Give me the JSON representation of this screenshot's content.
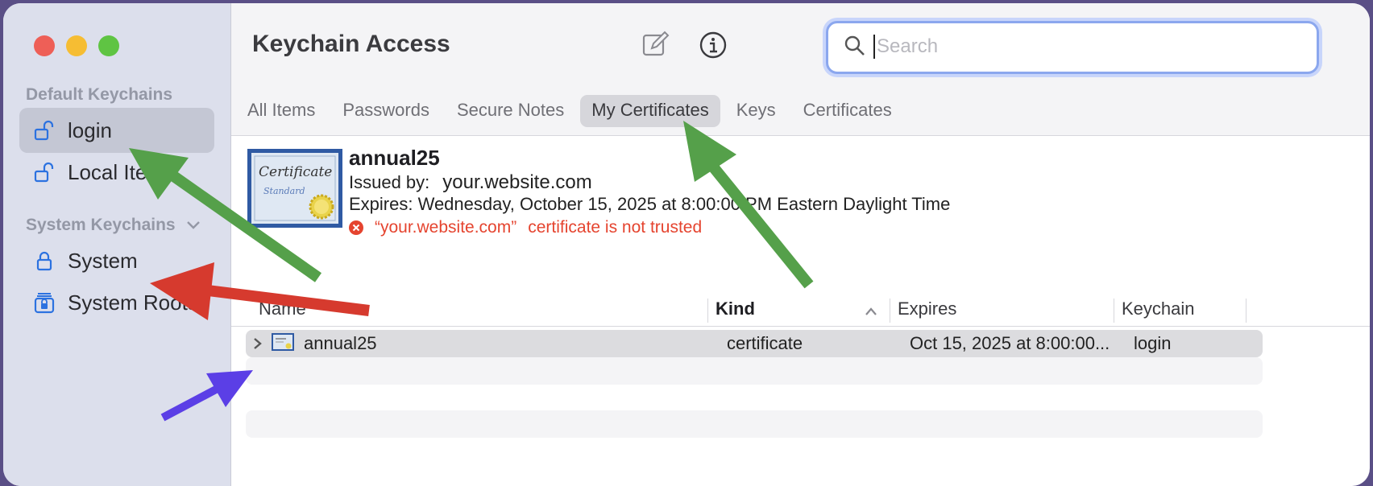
{
  "app": {
    "title": "Keychain Access"
  },
  "sidebar": {
    "default_header": "Default Keychains",
    "system_header": "System Keychains",
    "items": [
      {
        "label": "login",
        "icon": "unlocked-padlock-icon",
        "selected": true
      },
      {
        "label": "Local Items",
        "icon": "unlocked-padlock-icon",
        "selected": false
      },
      {
        "label": "System",
        "icon": "locked-padlock-icon",
        "selected": false
      },
      {
        "label": "System Roots",
        "icon": "certificate-cabinet-icon",
        "selected": false
      }
    ]
  },
  "search": {
    "placeholder": "Search",
    "value": ""
  },
  "tabs": [
    "All Items",
    "Passwords",
    "Secure Notes",
    "My Certificates",
    "Keys",
    "Certificates"
  ],
  "active_tab": "My Certificates",
  "detail": {
    "name": "annual25",
    "issued_label": "Issued by:",
    "issuer": "your.website.com",
    "expires": "Expires: Wednesday, October 15, 2025 at 8:00:00 PM Eastern Daylight Time",
    "error_quote": "“your.website.com”",
    "error_text": "certificate is not trusted",
    "cert_image_text": "Certificate",
    "cert_image_subtext": "Standard"
  },
  "table": {
    "columns": {
      "name": "Name",
      "kind": "Kind",
      "expires": "Expires",
      "keychain": "Keychain"
    },
    "sort_column": "Kind",
    "sort_direction": "ascending",
    "rows": [
      {
        "name": "annual25",
        "kind": "certificate",
        "expires": "Oct 15, 2025 at 8:00:00...",
        "keychain": "login"
      }
    ]
  },
  "colors": {
    "accent": "#8ba7ee",
    "error": "#e5442f",
    "annotation_green": "#55a04a",
    "annotation_red": "#d63a2e",
    "annotation_blue": "#5b3fe6"
  }
}
